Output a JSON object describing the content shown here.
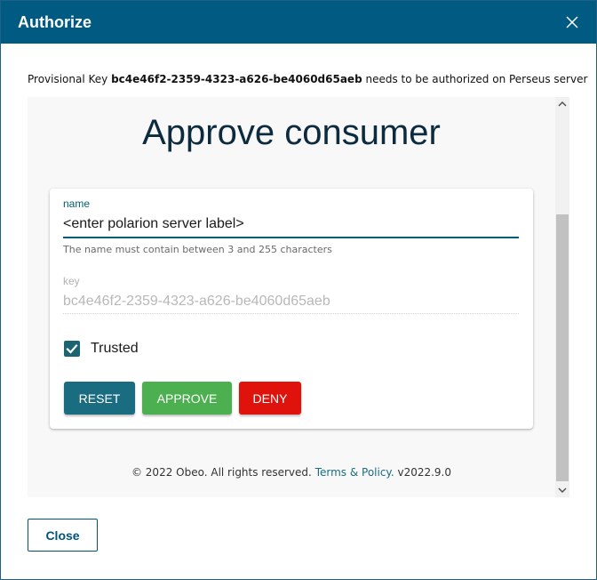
{
  "dialog": {
    "title": "Authorize",
    "intro_prefix": "Provisional Key",
    "intro_key": "bc4e46f2-2359-4323-a626-be4060d65aeb",
    "intro_suffix": "needs to be authorized on Perseus server",
    "close_button": "Close"
  },
  "form": {
    "heading": "Approve consumer",
    "name_label": "name",
    "name_value": "<enter polarion server label>",
    "name_hint": "The name must contain between 3 and 255 characters",
    "key_label": "key",
    "key_value": "bc4e46f2-2359-4323-a626-be4060d65aeb",
    "trusted_label": "Trusted",
    "trusted_checked": true,
    "buttons": {
      "reset": "RESET",
      "approve": "APPROVE",
      "deny": "DENY"
    }
  },
  "footer": {
    "copyright": "© 2022 Obeo. All rights reserved.",
    "link": "Terms & Policy.",
    "version": "v2022.9.0"
  },
  "colors": {
    "titlebar": "#005a82",
    "accent": "#00606f",
    "approve": "#4cb050",
    "deny": "#e0130c",
    "reset": "#1a6c80"
  },
  "icons": [
    "close-icon",
    "check-icon",
    "scroll-up-icon",
    "scroll-down-icon"
  ]
}
